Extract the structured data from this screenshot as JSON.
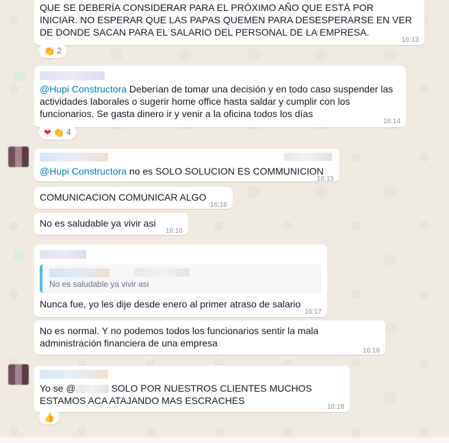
{
  "messages": [
    {
      "text": "QUE SE DEBERÍA CONSIDERAR PARA EL PRÓXIMO AÑO QUE ESTÁ POR INICIAR. NO ESPERAR QUE LAS PAPAS QUEMEN PARA DESESPERARSE EN VER DE DONDE SACAN PARA EL SALARIO DEL PERSONAL DE LA EMPRESA.",
      "time": "16:13",
      "reaction_count": "2"
    },
    {
      "mention": "@Hupi Constructora",
      "text": " Deberían de tomar una decisión y en todo caso suspender las actividades laborales o sugerir home office hasta saldar y cumplir con los funcionarios. Se gasta dinero ir y venir a la oficina todos los días",
      "time": "16:14",
      "reaction_count": "4"
    },
    {
      "mention": "@Hupi Constructora",
      "text": " no es SOLO SOLUCION ES COMMUNICION",
      "time": "16:15"
    },
    {
      "text": "COMUNICACION COMUNICAR ALGO",
      "time": "16:16"
    },
    {
      "text": "No es saludable ya vivir asi",
      "time": "16:16"
    },
    {
      "quote": "No es saludable ya vivir asi",
      "text": "Nunca fue, yo les dije desde enero al primer atraso de salario",
      "time": "16:17"
    },
    {
      "text": "No es normal. Y no podemos todos los funcionarios sentir la mala administración financiera de una empresa",
      "time": "16:18"
    },
    {
      "text_prefix": "Yo se @",
      "text": " SOLO POR NUESTROS CLIENTES MUCHOS ESTAMOS ACA ATAJANDO MAS ESCRACHES",
      "time": "16:18"
    }
  ],
  "icons": {
    "heart": "❤",
    "clap": "👏",
    "thumbs": "👍"
  },
  "colors": {
    "background": "#efeae2",
    "bubble": "#ffffff",
    "mention": "#027eb5",
    "timestamp": "#8696a0",
    "quote_bar": "#53bdeb"
  }
}
